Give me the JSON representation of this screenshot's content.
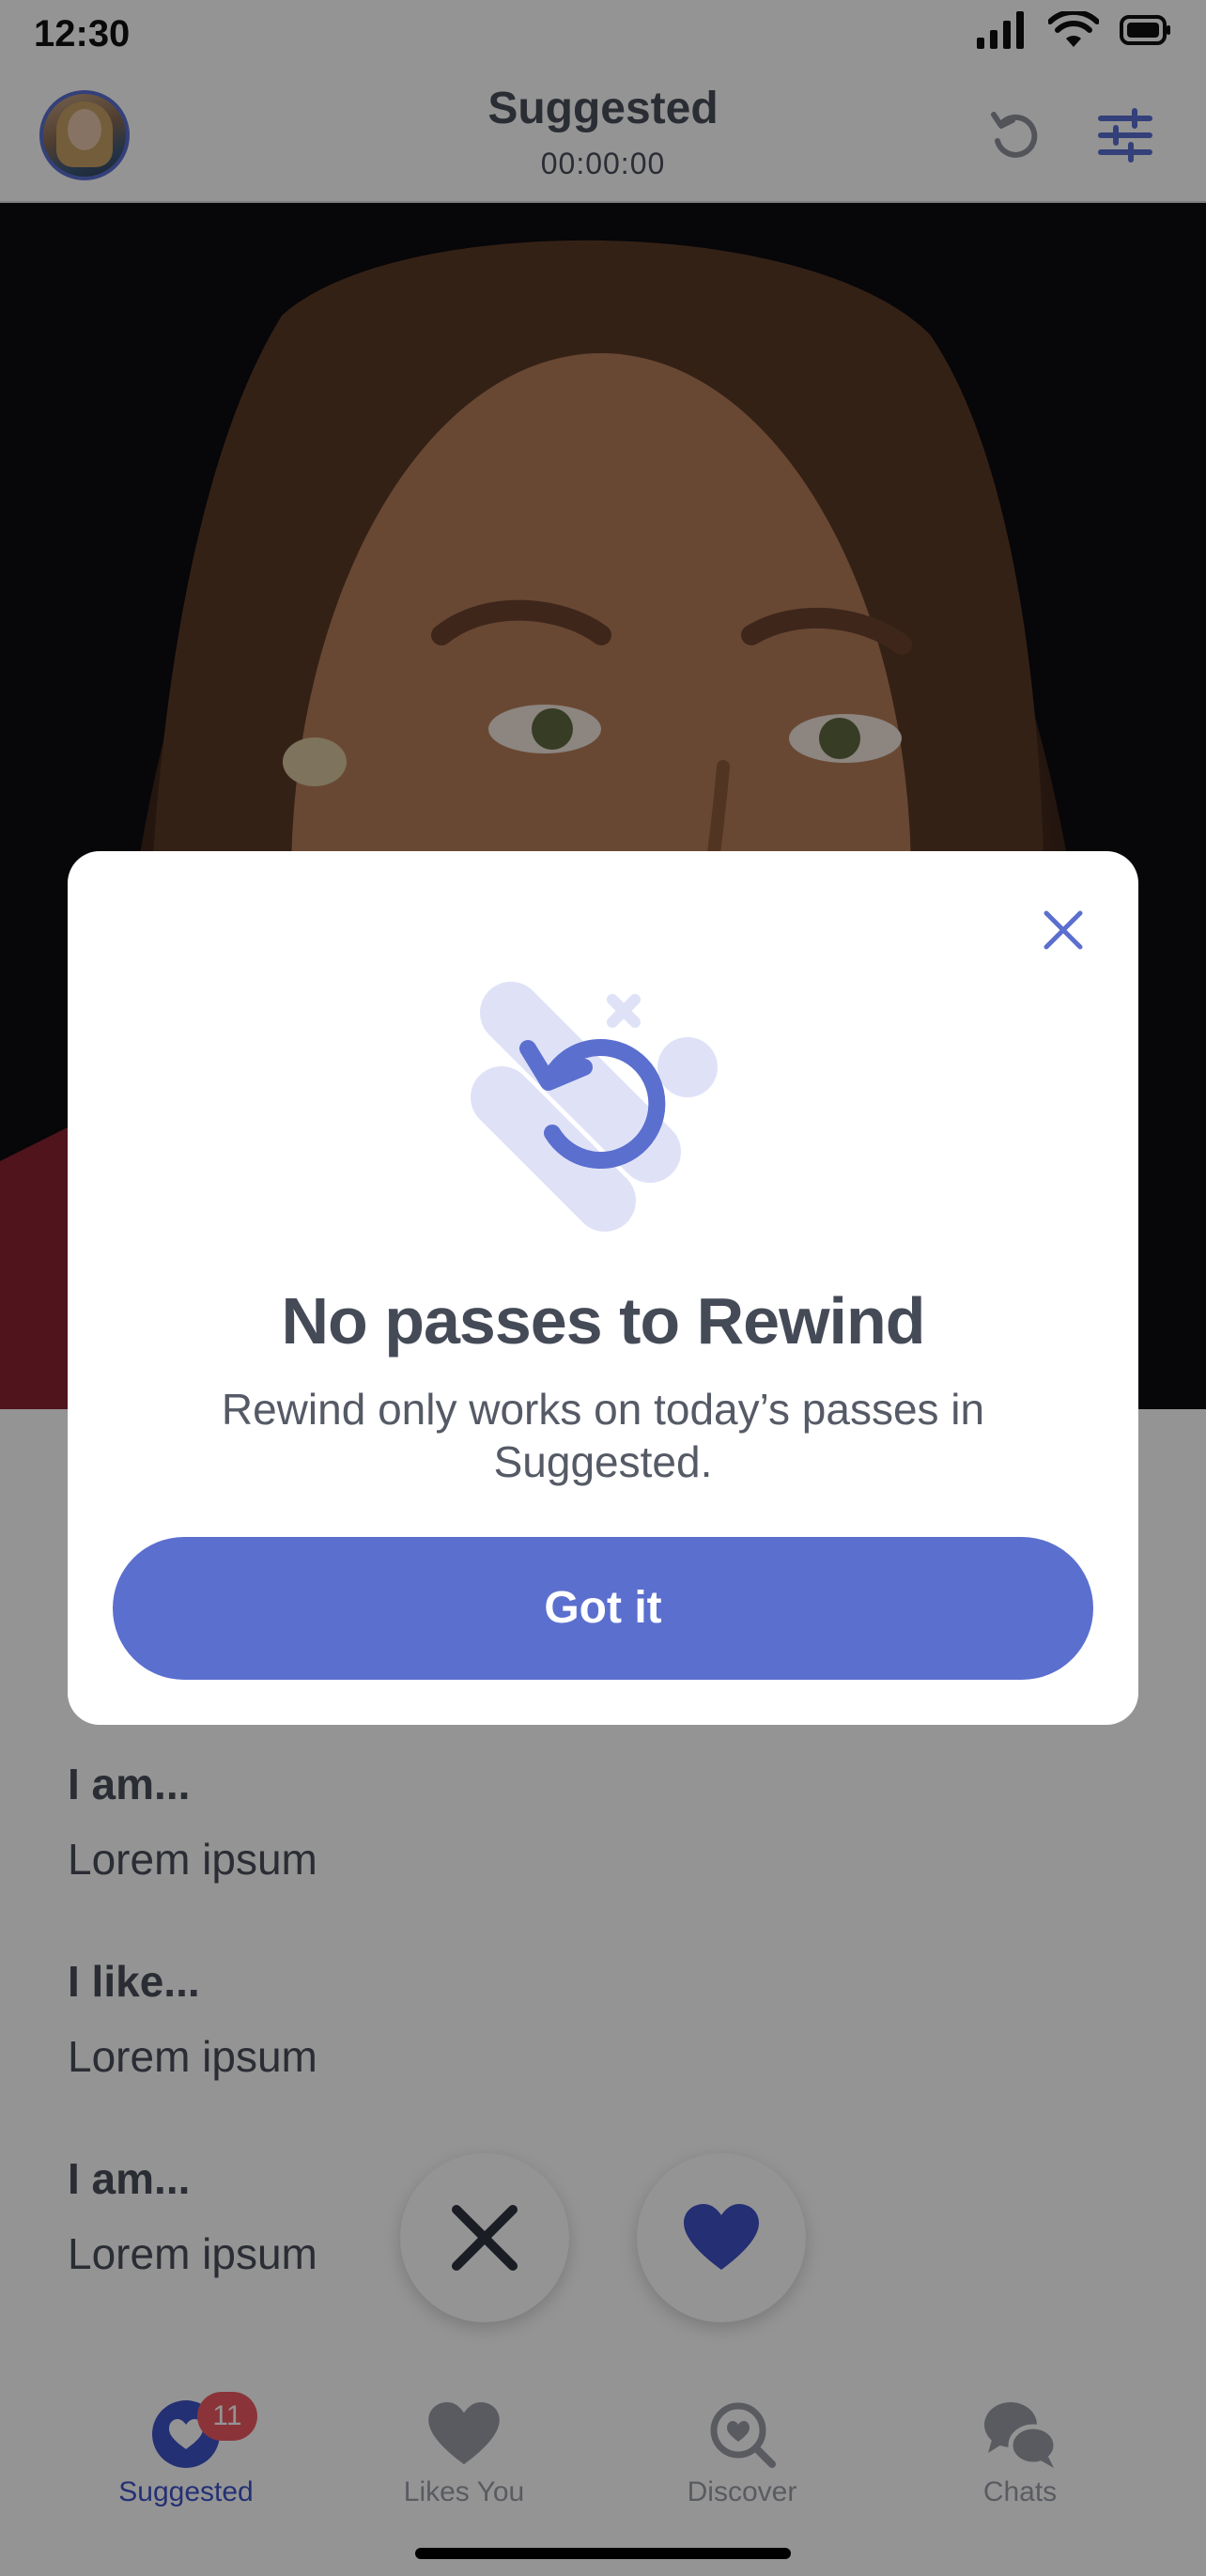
{
  "status_bar": {
    "time": "12:30"
  },
  "header": {
    "title": "Suggested",
    "timer": "00:00:00"
  },
  "profile": {
    "prompts": [
      {
        "title": "I am...",
        "answer": "Lorem ipsum"
      },
      {
        "title": "I like...",
        "answer": "Lorem ipsum"
      },
      {
        "title": "I am...",
        "answer": "Lorem ipsum"
      }
    ]
  },
  "bottom_nav": {
    "items": [
      {
        "label": "Suggested",
        "badge": "11",
        "icon": "heart-bubble-icon"
      },
      {
        "label": "Likes You",
        "icon": "heart-icon"
      },
      {
        "label": "Discover",
        "icon": "discover-icon"
      },
      {
        "label": "Chats",
        "icon": "chat-bubbles-icon"
      }
    ]
  },
  "modal": {
    "title": "No passes to Rewind",
    "body": "Rewind only works on today’s passes in Suggested.",
    "button_label": "Got it"
  },
  "colors": {
    "accent": "#5b6fcf",
    "badge": "#ee5b63",
    "text_dark": "#454a57"
  }
}
